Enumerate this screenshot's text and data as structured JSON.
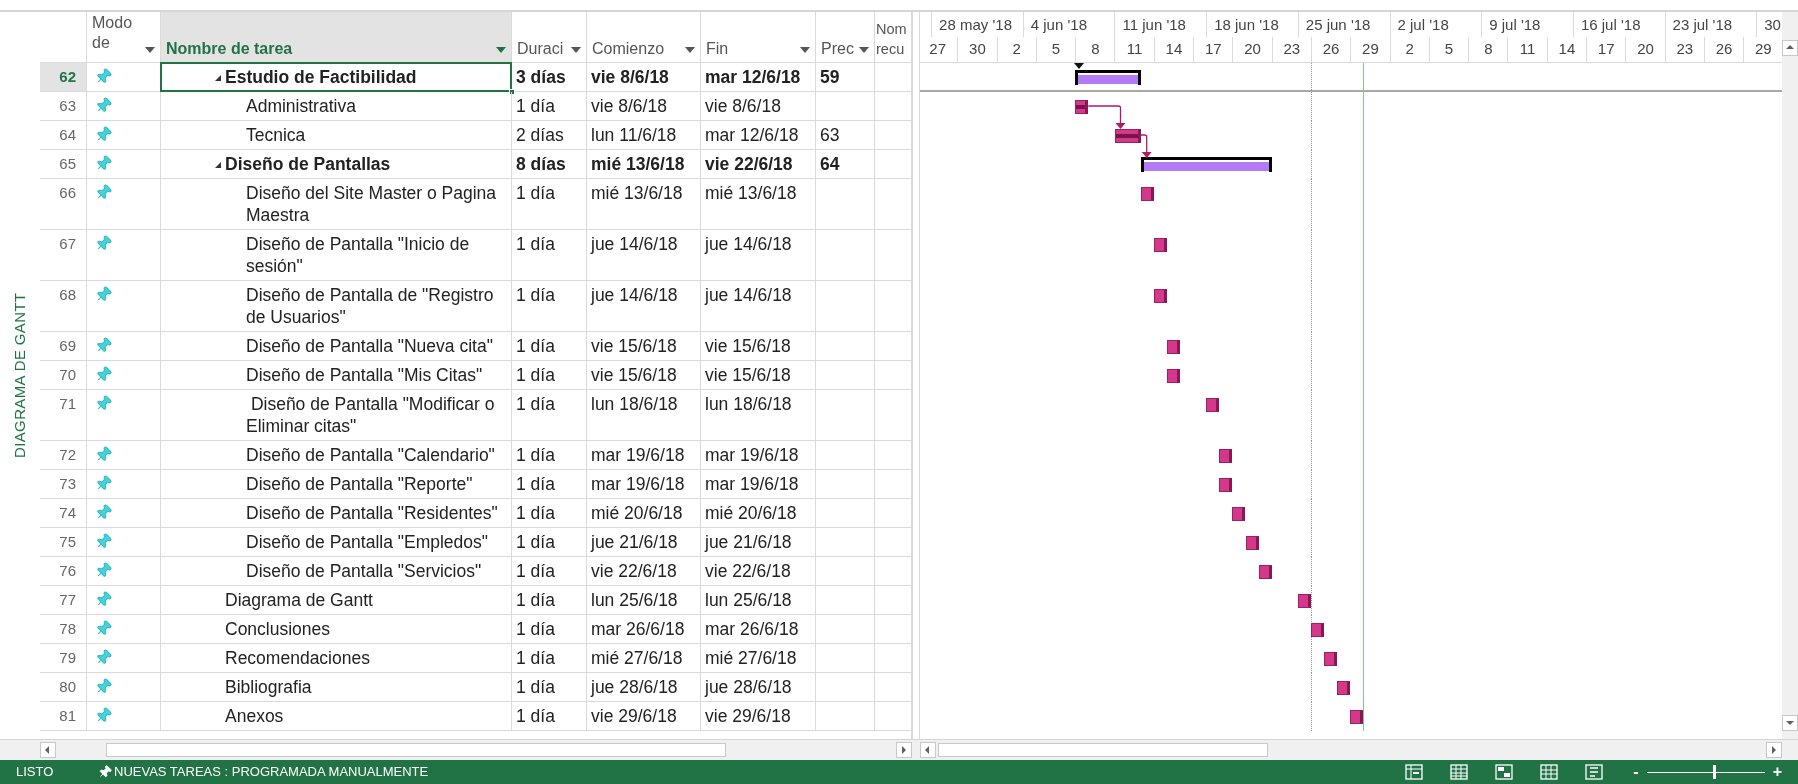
{
  "view_label": "DIAGRAMA DE GANTT",
  "columns": [
    {
      "label": "Modo de",
      "selected": false
    },
    {
      "label": "Nombre de tarea",
      "selected": true
    },
    {
      "label": "Duraci",
      "selected": false
    },
    {
      "label": "Comienzo",
      "selected": false
    },
    {
      "label": "Fin",
      "selected": false
    },
    {
      "label": "Prec",
      "selected": false
    },
    {
      "label": "Nom recu",
      "selected": false
    }
  ],
  "timescale": {
    "weeks": [
      "28 may '18",
      "4 jun '18",
      "11 jun '18",
      "18 jun '18",
      "25 jun '18",
      "2 jul '18",
      "9 jul '18",
      "16 jul '18",
      "23 jul '18",
      "30"
    ],
    "days": [
      "27",
      "30",
      "2",
      "5",
      "8",
      "11",
      "14",
      "17",
      "20",
      "23",
      "26",
      "29",
      "2",
      "5",
      "8",
      "11",
      "14",
      "17",
      "20",
      "23",
      "26",
      "29"
    ]
  },
  "tasks": [
    {
      "id": "62",
      "kind": "summary",
      "name": "Estudio de Factibilidad",
      "duration": "3 días",
      "start": "vie 8/6/18",
      "finish": "mar 12/6/18",
      "predecessors": "59",
      "expanded": true,
      "complete": false,
      "selected": true,
      "children": [
        {
          "id": "63",
          "kind": "task",
          "name": "Administrativa",
          "duration": "1 día",
          "start": "vie 8/6/18",
          "finish": "vie 8/6/18",
          "complete": true,
          "selected": false
        },
        {
          "id": "64",
          "kind": "task",
          "name": "Tecnica",
          "duration": "2 días",
          "start": "lun 11/6/18",
          "finish": "mar 12/6/18",
          "predecessors": "63",
          "complete": true,
          "selected": false
        }
      ]
    },
    {
      "id": "65",
      "kind": "summary",
      "name": "Diseño de Pantallas",
      "duration": "8 días",
      "start": "mié 13/6/18",
      "finish": "vie 22/6/18",
      "predecessors": "64",
      "expanded": true,
      "complete": false,
      "selected": false,
      "children": [
        {
          "id": "66",
          "kind": "task",
          "name": "Diseño del Site Master o Pagina Maestra",
          "duration": "1 día",
          "start": "mié 13/6/18",
          "finish": "mié 13/6/18",
          "complete": false,
          "selected": false
        },
        {
          "id": "67",
          "kind": "task",
          "name": "Diseño de Pantalla \"Inicio de sesión\"",
          "duration": "1 día",
          "start": "jue 14/6/18",
          "finish": "jue 14/6/18",
          "complete": false,
          "selected": false
        },
        {
          "id": "68",
          "kind": "task",
          "name": "Diseño de Pantalla de \"Registro de Usuarios\"",
          "duration": "1 día",
          "start": "jue 14/6/18",
          "finish": "jue 14/6/18",
          "complete": false,
          "selected": false
        },
        {
          "id": "69",
          "kind": "task",
          "name": "Diseño de Pantalla \"Nueva cita\"",
          "duration": "1 día",
          "start": "vie 15/6/18",
          "finish": "vie 15/6/18",
          "complete": false,
          "selected": false
        },
        {
          "id": "70",
          "kind": "task",
          "name": "Diseño de Pantalla \"Mis Citas\"",
          "duration": "1 día",
          "start": "vie 15/6/18",
          "finish": "vie 15/6/18",
          "complete": false,
          "selected": false
        },
        {
          "id": "71",
          "kind": "task",
          "name": " Diseño de Pantalla \"Modificar o Eliminar citas\"",
          "duration": "1 día",
          "start": "lun 18/6/18",
          "finish": "lun 18/6/18",
          "complete": false,
          "selected": false
        },
        {
          "id": "72",
          "kind": "task",
          "name": "Diseño de Pantalla \"Calendario\"",
          "duration": "1 día",
          "start": "mar 19/6/18",
          "finish": "mar 19/6/18",
          "complete": false,
          "selected": false
        },
        {
          "id": "73",
          "kind": "task",
          "name": "Diseño de Pantalla \"Reporte\"",
          "duration": "1 día",
          "start": "mar 19/6/18",
          "finish": "mar 19/6/18",
          "complete": false,
          "selected": false
        },
        {
          "id": "74",
          "kind": "task",
          "name": "Diseño de Pantalla \"Residentes\"",
          "duration": "1 día",
          "start": "mié 20/6/18",
          "finish": "mié 20/6/18",
          "complete": false,
          "selected": false
        },
        {
          "id": "75",
          "kind": "task",
          "name": "Diseño de Pantalla \"Empledos\"",
          "duration": "1 día",
          "start": "jue 21/6/18",
          "finish": "jue 21/6/18",
          "complete": false,
          "selected": false
        },
        {
          "id": "76",
          "kind": "task",
          "name": "Diseño de Pantalla \"Servicios\"",
          "duration": "1 día",
          "start": "vie 22/6/18",
          "finish": "vie 22/6/18",
          "complete": false,
          "selected": false
        }
      ]
    },
    {
      "id": "77",
      "kind": "task",
      "name": "Diagrama de Gantt",
      "duration": "1 día",
      "start": "lun 25/6/18",
      "finish": "lun 25/6/18",
      "complete": false,
      "selected": false
    },
    {
      "id": "78",
      "kind": "task",
      "name": "Conclusiones",
      "duration": "1 día",
      "start": "mar 26/6/18",
      "finish": "mar 26/6/18",
      "complete": false,
      "selected": false
    },
    {
      "id": "79",
      "kind": "task",
      "name": "Recomendaciones",
      "duration": "1 día",
      "start": "mié 27/6/18",
      "finish": "mié 27/6/18",
      "complete": false,
      "selected": false
    },
    {
      "id": "80",
      "kind": "task",
      "name": "Bibliografia",
      "duration": "1 día",
      "start": "jue 28/6/18",
      "finish": "jue 28/6/18",
      "complete": false,
      "selected": false
    },
    {
      "id": "81",
      "kind": "task",
      "name": "Anexos",
      "duration": "1 día",
      "start": "vie 29/6/18",
      "finish": "vie 29/6/18",
      "complete": false,
      "selected": false
    }
  ],
  "status_bar": {
    "mode": "LISTO",
    "new_tasks": "NUEVAS TAREAS : PROGRAMADA MANUALMENTE",
    "zoom_out": "-",
    "zoom_in": "+",
    "zoom_slider": {
      "level": 0.57
    }
  }
}
